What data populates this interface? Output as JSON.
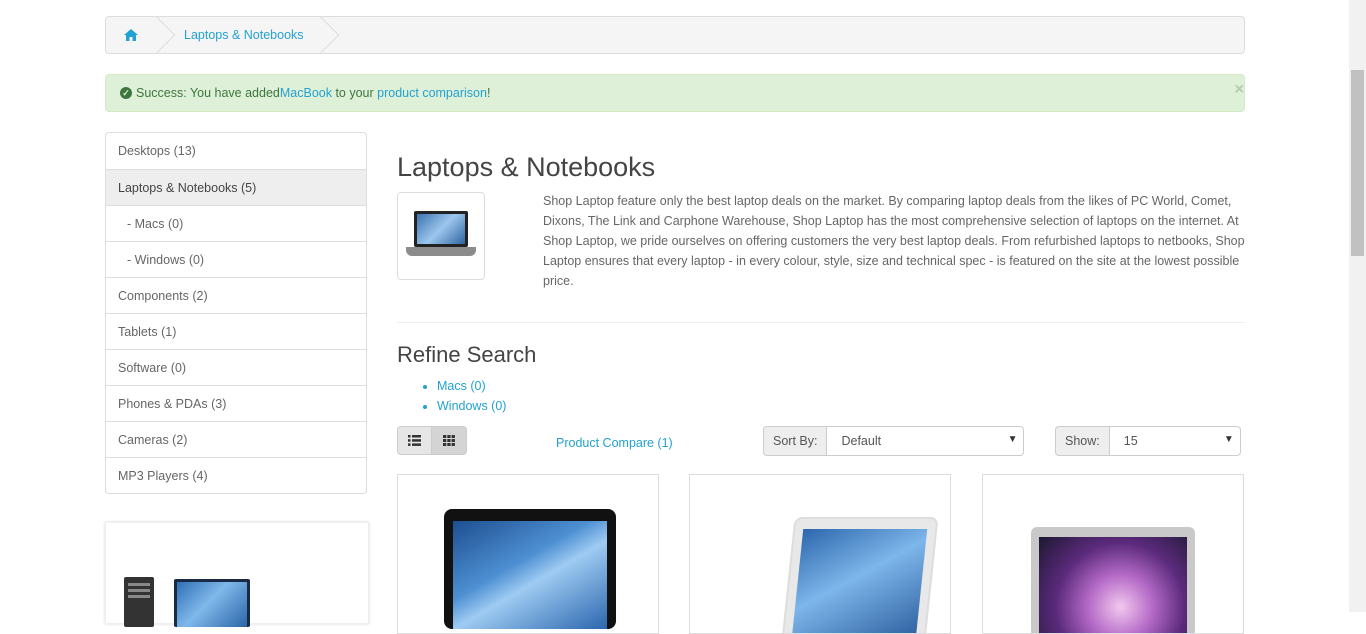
{
  "breadcrumb": {
    "home_icon": "home-icon",
    "items": [
      "Laptops & Notebooks"
    ]
  },
  "alert": {
    "prefix": "Success: You have added ",
    "product_link": "MacBook",
    "middle": " to your ",
    "comparison_link": "product comparison",
    "suffix": "!",
    "close": "×"
  },
  "sidebar": {
    "categories": [
      {
        "label": "Desktops (13)"
      },
      {
        "label": "Laptops & Notebooks (5)"
      },
      {
        "label": "- Macs (0)"
      },
      {
        "label": "- Windows (0)"
      },
      {
        "label": "Components (2)"
      },
      {
        "label": "Tablets (1)"
      },
      {
        "label": "Software (0)"
      },
      {
        "label": "Phones & PDAs (3)"
      },
      {
        "label": "Cameras (2)"
      },
      {
        "label": "MP3 Players (4)"
      }
    ]
  },
  "category": {
    "title": "Laptops & Notebooks",
    "description": "Shop Laptop feature only the best laptop deals on the market. By comparing laptop deals from the likes of PC World, Comet, Dixons, The Link and Carphone Warehouse, Shop Laptop has the most comprehensive selection of laptops on the internet. At Shop Laptop, we pride ourselves on offering customers the very best laptop deals. From refurbished laptops to netbooks, Shop Laptop ensures that every laptop - in every colour, style, size and technical spec - is featured on the site at the lowest possible price."
  },
  "refine": {
    "heading": "Refine Search",
    "links": [
      "Macs (0)",
      "Windows (0)"
    ]
  },
  "toolbar": {
    "list_view_icon": "list-icon",
    "grid_view_icon": "grid-icon",
    "compare_link": "Product Compare (1)",
    "sort_label": "Sort By:",
    "sort_value": "Default",
    "show_label": "Show:",
    "show_value": "15"
  },
  "colors": {
    "link": "#23a1d1",
    "success_bg": "#dff0d8",
    "success_text": "#3c763d"
  }
}
